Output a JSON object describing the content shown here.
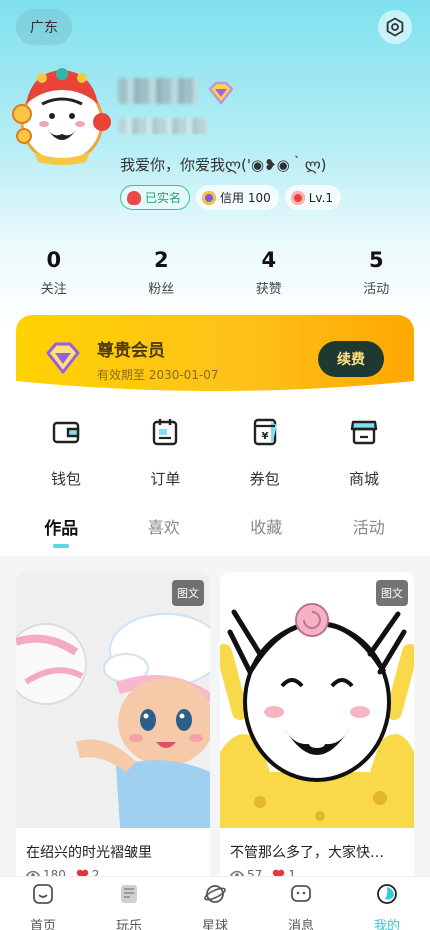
{
  "header": {
    "location": "广东",
    "bio": "我爱你，你爱我ლ('◉❥◉｀ლ)",
    "tags": {
      "verified": "已实名",
      "credit": "信用 100",
      "level": "Lv.1"
    }
  },
  "stats": [
    {
      "num": "0",
      "label": "关注"
    },
    {
      "num": "2",
      "label": "粉丝"
    },
    {
      "num": "4",
      "label": "获赞"
    },
    {
      "num": "5",
      "label": "活动"
    }
  ],
  "vip": {
    "title": "尊贵会员",
    "expiry": "有效期至 2030-01-07",
    "renew_label": "续费"
  },
  "quick_links": [
    {
      "label": "钱包",
      "icon": "wallet-icon"
    },
    {
      "label": "订单",
      "icon": "order-icon"
    },
    {
      "label": "券包",
      "icon": "coupon-icon"
    },
    {
      "label": "商城",
      "icon": "shop-icon"
    }
  ],
  "tabs": [
    {
      "label": "作品",
      "active": true
    },
    {
      "label": "喜欢",
      "active": false
    },
    {
      "label": "收藏",
      "active": false
    },
    {
      "label": "活动",
      "active": false
    }
  ],
  "posts": [
    {
      "badge": "图文",
      "title": "在绍兴的时光褶皱里",
      "views": "180",
      "likes": "2"
    },
    {
      "badge": "图文",
      "title": "不管那么多了，大家快…",
      "views": "57",
      "likes": "1"
    }
  ],
  "bottom_nav": [
    {
      "label": "首页",
      "icon": "home-icon",
      "active": false
    },
    {
      "label": "玩乐",
      "icon": "play-icon",
      "active": false
    },
    {
      "label": "星球",
      "icon": "planet-icon",
      "active": false
    },
    {
      "label": "消息",
      "icon": "message-icon",
      "active": false
    },
    {
      "label": "我的",
      "icon": "profile-icon",
      "active": true
    }
  ],
  "colors": {
    "accent": "#36c7dc",
    "vip_gold": "#ffc21a",
    "renew_bg": "#1e3832"
  }
}
